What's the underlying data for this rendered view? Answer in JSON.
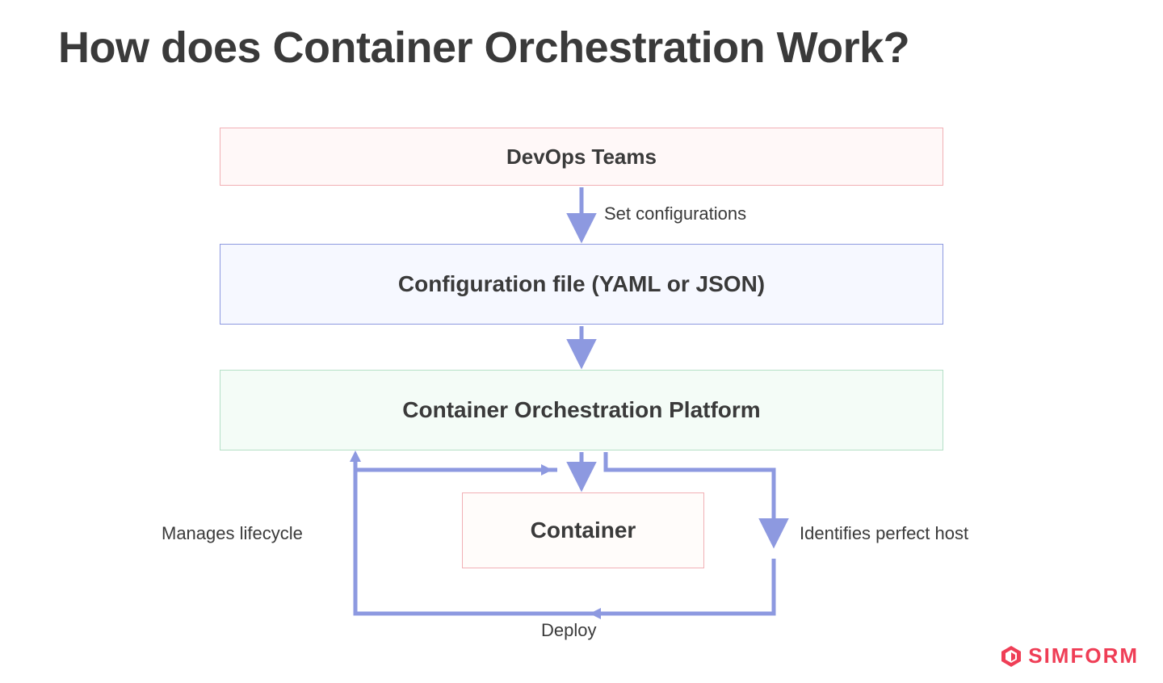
{
  "title": "How does Container Orchestration Work?",
  "boxes": {
    "devops": "DevOps Teams",
    "config": "Configuration file (YAML or JSON)",
    "platform": "Container Orchestration Platform",
    "container": "Container"
  },
  "labels": {
    "set_config": "Set configurations",
    "lifecycle": "Manages lifecycle",
    "host": "Identifies perfect host",
    "deploy": "Deploy"
  },
  "brand": "SIMFORM",
  "colors": {
    "arrow": "#8d99e0",
    "brand": "#ef3e56"
  }
}
